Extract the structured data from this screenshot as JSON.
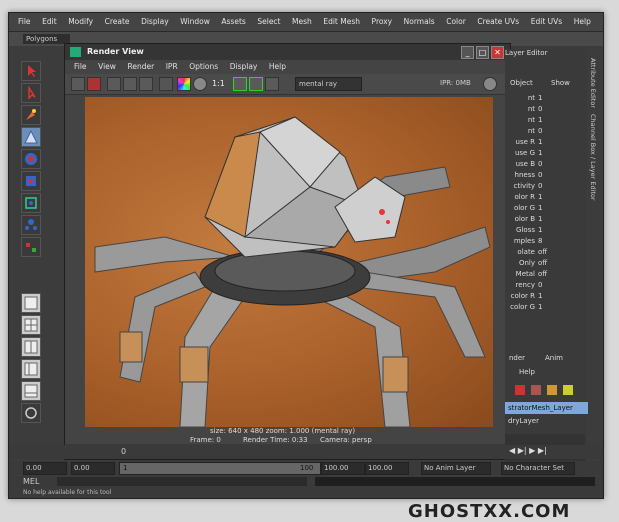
{
  "menubar": [
    "File",
    "Edit",
    "Modify",
    "Create",
    "Display",
    "Window",
    "Assets",
    "Select",
    "Mesh",
    "Edit Mesh",
    "Proxy",
    "Normals",
    "Color",
    "Create UVs",
    "Edit UVs",
    "Help"
  ],
  "menuset": "Polygons",
  "render_view": {
    "title": "Render View",
    "menu": [
      "File",
      "View",
      "Render",
      "IPR",
      "Options",
      "Display",
      "Help"
    ],
    "ratio_label": "1:1",
    "renderer": "mental ray",
    "ipr_status": "IPR: 0MB",
    "info_line1": "size: 640 x 480 zoom: 1.000      (mental ray)",
    "info_frame": "Frame: 0",
    "info_render_time": "Render Time: 0:33",
    "info_camera": "Camera: persp"
  },
  "right_panel": {
    "header": "Layer Editor",
    "object_label": "Object",
    "show_label": "Show",
    "attributes": [
      {
        "k": "nt",
        "v": "1"
      },
      {
        "k": "nt",
        "v": "0"
      },
      {
        "k": "nt",
        "v": "1"
      },
      {
        "k": "nt",
        "v": "0"
      },
      {
        "k": "use R",
        "v": "1"
      },
      {
        "k": "use G",
        "v": "1"
      },
      {
        "k": "use B",
        "v": "0"
      },
      {
        "k": "hness",
        "v": "0"
      },
      {
        "k": "ctivity",
        "v": "0"
      },
      {
        "k": "olor R",
        "v": "1"
      },
      {
        "k": "olor G",
        "v": "1"
      },
      {
        "k": "olor B",
        "v": "1"
      },
      {
        "k": "Gloss",
        "v": "1"
      },
      {
        "k": "mples",
        "v": "8"
      },
      {
        "k": "olate",
        "v": "off"
      },
      {
        "k": "Only",
        "v": "off"
      },
      {
        "k": "Metal",
        "v": "off"
      },
      {
        "k": "rency",
        "v": "0"
      },
      {
        "k": "color R",
        "v": "1"
      },
      {
        "k": "color G",
        "v": "1"
      }
    ],
    "tab_render": "nder",
    "tab_anim": "Anim",
    "help_label": "Help",
    "layers": [
      "stratorMesh_Layer",
      "dryLayer"
    ]
  },
  "vertical_tabs": [
    "Attribute Editor",
    "Channel Box / Layer Editor"
  ],
  "timeline": {
    "start_field": "0.00",
    "current_field": "0.00",
    "range_start": "1",
    "range_end": "100",
    "end1": "100.00",
    "end2": "100.00",
    "anim_layer": "No Anim Layer",
    "char_set": "No Character Set",
    "frame_marker": "0"
  },
  "mel_label": "MEL",
  "help_line": "No help available for this tool",
  "watermark": "GHOSTXX.COM"
}
